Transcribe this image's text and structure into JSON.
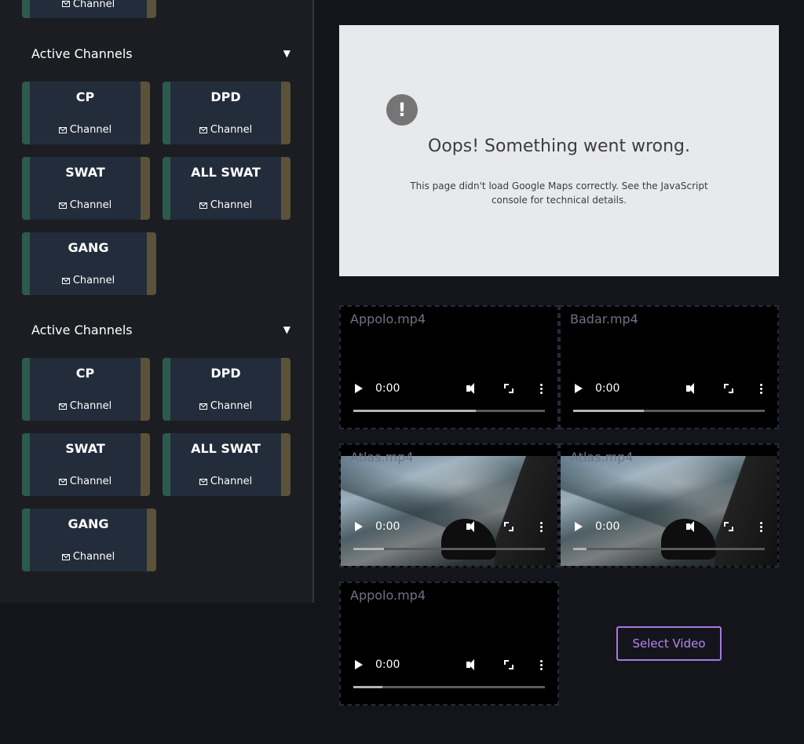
{
  "sidebar": {
    "partial_card": {
      "label": "Channel"
    },
    "sections": [
      {
        "title": "Active Channels",
        "caret": "▼",
        "cards": [
          {
            "name": "CP",
            "label": "Channel"
          },
          {
            "name": "DPD",
            "label": "Channel"
          },
          {
            "name": "SWAT",
            "label": "Channel"
          },
          {
            "name": "ALL SWAT",
            "label": "Channel"
          },
          {
            "name": "GANG",
            "label": "Channel"
          }
        ]
      },
      {
        "title": "Active Channels",
        "caret": "▼",
        "cards": [
          {
            "name": "CP",
            "label": "Channel"
          },
          {
            "name": "DPD",
            "label": "Channel"
          },
          {
            "name": "SWAT",
            "label": "Channel"
          },
          {
            "name": "ALL SWAT",
            "label": "Channel"
          },
          {
            "name": "GANG",
            "label": "Channel"
          }
        ]
      }
    ]
  },
  "map": {
    "icon": "warning-icon",
    "title": "Oops! Something went wrong.",
    "detail": "This page didn't load Google Maps correctly. See the JavaScript console for technical details."
  },
  "videos": [
    {
      "filename": "Appolo.mp4",
      "time": "0:00",
      "progress": 0.64,
      "thumbnail": false
    },
    {
      "filename": "Badar.mp4",
      "time": "0:00",
      "progress": 0.37,
      "thumbnail": false
    },
    {
      "filename": "Atlas.mp4",
      "time": "0:00",
      "progress": 0.16,
      "thumbnail": true
    },
    {
      "filename": "Atlas.mp4",
      "time": "0:00",
      "progress": 0.07,
      "thumbnail": true
    },
    {
      "filename": "Appolo.mp4",
      "time": "0:00",
      "progress": 0.15,
      "thumbnail": false
    }
  ],
  "select_button": {
    "label": "Select Video"
  },
  "colors": {
    "background": "#14151b",
    "sidebar": "#1c1d22",
    "card": "#232c3a",
    "card_left_accent": "#2d5a4e",
    "card_right_accent": "#5b5239",
    "button_accent": "#a678e0"
  }
}
